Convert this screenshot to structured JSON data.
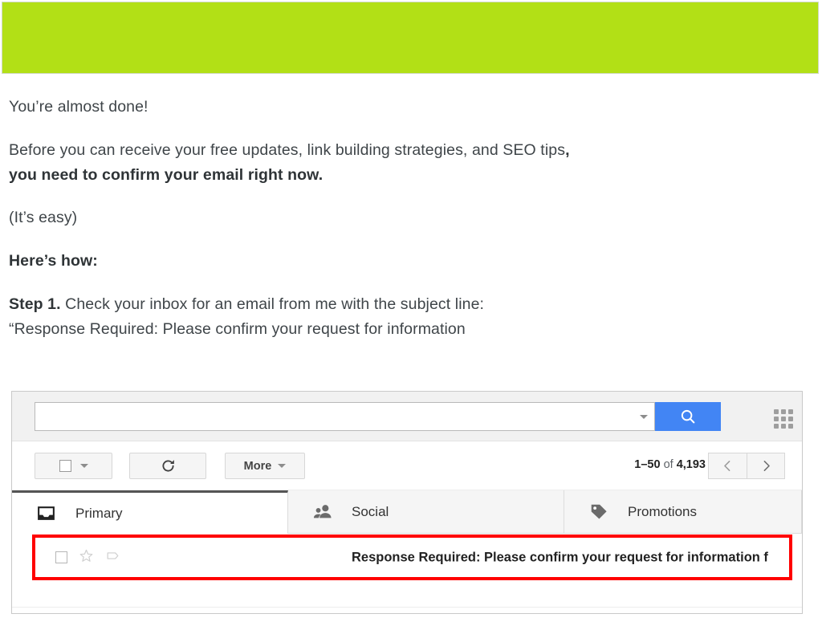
{
  "banner": {
    "color": "#b2e016",
    "alt": "green-header-banner"
  },
  "email_body": {
    "heading": "You’re almost done!",
    "para_before_plain": "Before you can receive your free updates, link building strategies, and SEO tips",
    "para_before_bold_comma": ",",
    "para_before_bold": "you need to confirm your email right now.",
    "para_easy": "(It’s easy)",
    "heres_how": "Here’s how:",
    "step_label": "Step 1.",
    "step_text": "Check your inbox for an email from me with the subject line:",
    "step_quote": "“Response Required: Please confirm your request for information"
  },
  "gmail": {
    "search": {
      "value": "",
      "placeholder": "",
      "caret_icon": "chevron-down-icon",
      "button_icon": "search-icon",
      "button_color": "#4285f4",
      "apps_icon": "apps-grid-icon"
    },
    "toolbar": {
      "select_all_icon": "checkbox-icon",
      "select_all_caret": "chevron-down-icon",
      "refresh_icon": "refresh-icon",
      "more_label": "More",
      "more_caret": "chevron-down-icon",
      "paging_range": "1–50",
      "paging_of": "of",
      "paging_total": "4,193",
      "prev_icon": "chevron-left-icon",
      "next_icon": "chevron-right-icon"
    },
    "tabs": [
      {
        "label": "Primary",
        "icon": "inbox-icon",
        "active": true
      },
      {
        "label": "Social",
        "icon": "people-icon",
        "active": false
      },
      {
        "label": "Promotions",
        "icon": "tag-icon",
        "active": false
      }
    ],
    "row": {
      "checkbox_icon": "checkbox-icon",
      "star_icon": "star-outline-icon",
      "important_icon": "importance-marker-icon",
      "subject": "Response Required: Please confirm your request for information f",
      "highlight_color": "#ff0000"
    }
  }
}
